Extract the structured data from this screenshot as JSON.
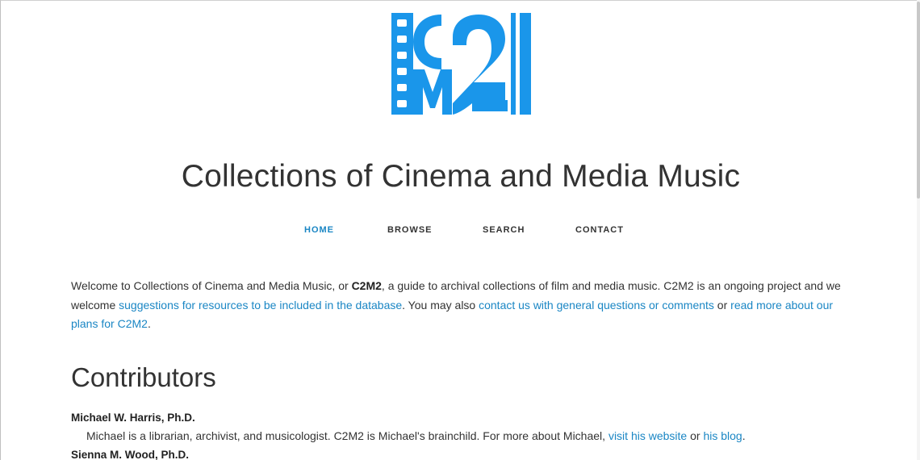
{
  "site": {
    "title": "Collections of Cinema and Media Music",
    "logo_text": "C2M2",
    "brand_color": "#1a86c4",
    "logo_color": "#1a96ea"
  },
  "nav": {
    "items": [
      {
        "label": "HOME",
        "active": true
      },
      {
        "label": "BROWSE",
        "active": false
      },
      {
        "label": "SEARCH",
        "active": false
      },
      {
        "label": "CONTACT",
        "active": false
      }
    ]
  },
  "intro": {
    "t1": "Welcome to Collections of Cinema and Media Music, or ",
    "bold": "C2M2",
    "t2": ", a guide to archival collections of film and media music. C2M2 is an ongoing project and we welcome ",
    "link1": "suggestions for resources to be included in the database",
    "t3": ". You may also ",
    "link2": "contact us with general questions or comments",
    "t4": " or ",
    "link3": "read more about our plans for C2M2",
    "t5": "."
  },
  "contributors": {
    "heading": "Contributors",
    "people": [
      {
        "name": "Michael W. Harris, Ph.D.",
        "bio_text": "Michael is a librarian, archivist, and musicologist. C2M2 is Michael's brainchild. For more about Michael, ",
        "link1": "visit his website",
        "mid": " or ",
        "link2": "his blog",
        "end": "."
      },
      {
        "name": "Sienna M. Wood, Ph.D."
      }
    ]
  }
}
